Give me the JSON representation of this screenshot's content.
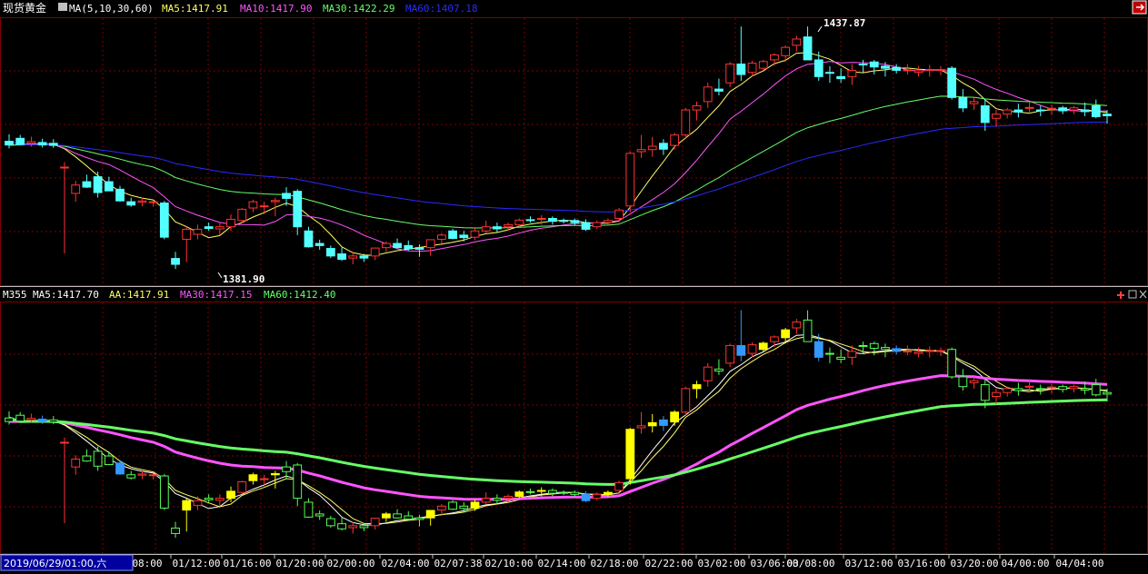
{
  "top_panel": {
    "title": "现货黄金",
    "ma_params": "MA(5,10,30,60)",
    "ma5_label": "MA5:1417.91",
    "ma10_label": "MA10:1417.90",
    "ma30_label": "MA30:1422.29",
    "ma60_label": "MA60:1407.18",
    "high_label": "1437.87",
    "low_label": "1381.90"
  },
  "bottom_panel": {
    "name": "M355",
    "ma5_label": "MA5:1417.70",
    "aa_label": "AA:1417.91",
    "ma30_label": "MA30:1417.15",
    "ma60_label": "MA60:1412.40"
  },
  "time_axis": {
    "cursor_time": "2019/06/29/01:00,六",
    "labels": [
      "08:00",
      "01/12:00",
      "01/16:00",
      "01/20:00",
      "02/00:00",
      "02/04:00",
      "02/07:38",
      "02/10:00",
      "02/14:00",
      "02/18:00",
      "02/22:00",
      "03/02:00",
      "03/06:00",
      "03/08:00",
      "03/12:00",
      "03/16:00",
      "03/20:00",
      "04/00:00",
      "04/04:00"
    ]
  },
  "colors": {
    "up": "#ff3232",
    "down": "#54ffff",
    "ma5": "#ffff66",
    "ma10": "#ff55ff",
    "ma30": "#66ff66",
    "ma60": "#2a2aff",
    "grid": "#800000",
    "yellow_bar": "#ffff00",
    "green_candle": "#54ff54",
    "blue_bar": "#3399ff"
  },
  "chart_data": [
    {
      "type": "line",
      "name": "candlestick",
      "title": "现货黄金",
      "ylim": [
        1378,
        1442
      ],
      "annotations": [
        {
          "label": "1437.87",
          "value": 1437.87
        },
        {
          "label": "1381.90",
          "value": 1381.9
        }
      ],
      "ohlc": [
        [
          1412.5,
          1414.2,
          1410.8,
          1411.6
        ],
        [
          1413.2,
          1414.0,
          1411.5,
          1411.7
        ],
        [
          1412.0,
          1413.6,
          1411.2,
          1412.4
        ],
        [
          1412.2,
          1413.1,
          1411.0,
          1411.6
        ],
        [
          1412.0,
          1413.0,
          1410.9,
          1411.5
        ],
        [
          1406.3,
          1407.5,
          1385.6,
          1406.3
        ],
        [
          1400.0,
          1403.0,
          1398.0,
          1402.0
        ],
        [
          1402.8,
          1404.5,
          1401.3,
          1401.5
        ],
        [
          1404.0,
          1405.2,
          1399.0,
          1400.2
        ],
        [
          1402.8,
          1404.0,
          1401.0,
          1400.6
        ],
        [
          1401.0,
          1401.8,
          1398.0,
          1398.2
        ],
        [
          1398.0,
          1399.0,
          1396.8,
          1397.2
        ],
        [
          1397.9,
          1399.0,
          1396.9,
          1398.2
        ],
        [
          1397.8,
          1398.2,
          1396.8,
          1398.0
        ],
        [
          1397.7,
          1398.2,
          1389.0,
          1389.5
        ],
        [
          1384.4,
          1386.0,
          1381.9,
          1383.0
        ],
        [
          1389.0,
          1392.0,
          1383.5,
          1391.4
        ],
        [
          1390.2,
          1392.5,
          1389.0,
          1391.4
        ],
        [
          1392.0,
          1393.0,
          1391.0,
          1391.6
        ],
        [
          1391.5,
          1393.0,
          1390.0,
          1392.0
        ],
        [
          1392.0,
          1395.0,
          1391.0,
          1393.8
        ],
        [
          1393.5,
          1396.5,
          1393.0,
          1396.2
        ],
        [
          1396.5,
          1398.5,
          1395.5,
          1398.0
        ],
        [
          1397.0,
          1398.0,
          1395.0,
          1397.0
        ],
        [
          1398.0,
          1399.0,
          1394.5,
          1398.3
        ],
        [
          1400.0,
          1401.5,
          1397.0,
          1398.8
        ],
        [
          1400.5,
          1401.0,
          1390.0,
          1392.0
        ],
        [
          1391.0,
          1392.0,
          1387.0,
          1387.2
        ],
        [
          1388.0,
          1388.9,
          1386.5,
          1387.5
        ],
        [
          1386.8,
          1387.5,
          1384.5,
          1385.0
        ],
        [
          1385.5,
          1387.0,
          1383.8,
          1384.2
        ],
        [
          1384.5,
          1386.0,
          1383.0,
          1385.0
        ],
        [
          1385.0,
          1385.5,
          1383.6,
          1384.5
        ],
        [
          1385.0,
          1387.0,
          1384.0,
          1386.9
        ],
        [
          1387.0,
          1388.5,
          1386.0,
          1388.0
        ],
        [
          1388.0,
          1389.2,
          1386.8,
          1387.0
        ],
        [
          1387.5,
          1388.7,
          1386.2,
          1386.7
        ],
        [
          1387.0,
          1387.8,
          1384.8,
          1386.6
        ],
        [
          1387.0,
          1389.0,
          1385.0,
          1388.9
        ],
        [
          1389.0,
          1390.5,
          1387.5,
          1390.0
        ],
        [
          1391.0,
          1391.5,
          1389.0,
          1389.2
        ],
        [
          1390.0,
          1391.0,
          1388.5,
          1389.4
        ],
        [
          1389.5,
          1391.7,
          1388.8,
          1391.0
        ],
        [
          1391.0,
          1393.5,
          1390.5,
          1392.0
        ],
        [
          1392.0,
          1393.0,
          1390.6,
          1391.5
        ],
        [
          1392.0,
          1393.0,
          1391.0,
          1392.5
        ],
        [
          1392.5,
          1394.0,
          1392.0,
          1393.6
        ],
        [
          1393.7,
          1394.5,
          1393.0,
          1393.5
        ],
        [
          1393.8,
          1394.8,
          1392.5,
          1394.0
        ],
        [
          1394.0,
          1394.5,
          1392.5,
          1393.3
        ],
        [
          1393.5,
          1394.0,
          1392.8,
          1393.4
        ],
        [
          1393.5,
          1394.0,
          1392.4,
          1393.0
        ],
        [
          1393.0,
          1393.8,
          1391.0,
          1391.4
        ],
        [
          1392.0,
          1393.5,
          1391.5,
          1393.0
        ],
        [
          1393.0,
          1394.0,
          1392.4,
          1393.5
        ],
        [
          1394.0,
          1396.5,
          1393.0,
          1396.0
        ],
        [
          1397.0,
          1410.0,
          1395.5,
          1409.6
        ],
        [
          1410.0,
          1414.0,
          1408.5,
          1410.5
        ],
        [
          1410.5,
          1413.5,
          1408.8,
          1411.3
        ],
        [
          1412.0,
          1413.0,
          1409.2,
          1410.6
        ],
        [
          1411.5,
          1414.5,
          1410.5,
          1414.0
        ],
        [
          1414.0,
          1420.5,
          1413.0,
          1420.0
        ],
        [
          1420.0,
          1422.0,
          1417.5,
          1421.0
        ],
        [
          1422.0,
          1426.5,
          1420.5,
          1425.5
        ],
        [
          1425.0,
          1427.5,
          1423.5,
          1424.5
        ],
        [
          1426.5,
          1431.5,
          1425.5,
          1431.0
        ],
        [
          1431.0,
          1440.0,
          1427.0,
          1428.5
        ],
        [
          1429.0,
          1431.8,
          1428.0,
          1431.2
        ],
        [
          1430.0,
          1432.0,
          1429.5,
          1431.6
        ],
        [
          1432.0,
          1433.6,
          1430.6,
          1433.2
        ],
        [
          1433.0,
          1435.5,
          1431.5,
          1435.0
        ],
        [
          1435.5,
          1437.8,
          1434.0,
          1437.0
        ],
        [
          1437.5,
          1440.0,
          1433.5,
          1432.0
        ],
        [
          1432.0,
          1434.0,
          1427.0,
          1428.0
        ],
        [
          1429.0,
          1430.5,
          1426.5,
          1428.8
        ],
        [
          1428.0,
          1430.0,
          1426.5,
          1427.5
        ],
        [
          1428.0,
          1431.0,
          1426.0,
          1429.5
        ],
        [
          1431.0,
          1432.0,
          1429.0,
          1430.8
        ],
        [
          1431.5,
          1432.0,
          1428.5,
          1430.3
        ],
        [
          1430.5,
          1431.5,
          1428.0,
          1430.0
        ],
        [
          1430.2,
          1431.0,
          1428.7,
          1429.5
        ],
        [
          1429.5,
          1431.0,
          1428.5,
          1429.6
        ],
        [
          1429.0,
          1430.5,
          1428.0,
          1429.4
        ],
        [
          1429.5,
          1430.8,
          1428.0,
          1429.7
        ],
        [
          1429.5,
          1430.5,
          1428.3,
          1429.7
        ],
        [
          1430.0,
          1430.5,
          1422.5,
          1423.0
        ],
        [
          1423.0,
          1425.0,
          1419.5,
          1420.5
        ],
        [
          1421.5,
          1423.0,
          1420.0,
          1422.0
        ],
        [
          1421.0,
          1422.5,
          1415.0,
          1417.0
        ],
        [
          1418.0,
          1420.0,
          1416.0,
          1419.0
        ],
        [
          1419.0,
          1420.5,
          1418.0,
          1420.0
        ],
        [
          1420.0,
          1421.5,
          1418.2,
          1419.5
        ],
        [
          1420.5,
          1422.0,
          1419.0,
          1420.6
        ],
        [
          1420.0,
          1421.0,
          1418.5,
          1419.8
        ],
        [
          1420.4,
          1421.3,
          1418.8,
          1420.4
        ],
        [
          1420.5,
          1421.0,
          1419.0,
          1419.8
        ],
        [
          1420.0,
          1421.0,
          1419.0,
          1420.5
        ],
        [
          1420.0,
          1421.8,
          1418.5,
          1419.6
        ],
        [
          1421.0,
          1422.5,
          1418.0,
          1418.4
        ],
        [
          1419.0,
          1420.0,
          1416.7,
          1418.6
        ]
      ]
    },
    {
      "type": "line",
      "name": "M355",
      "series": [
        {
          "name": "MA5"
        },
        {
          "name": "AA"
        },
        {
          "name": "MA30"
        },
        {
          "name": "MA60"
        }
      ]
    }
  ]
}
